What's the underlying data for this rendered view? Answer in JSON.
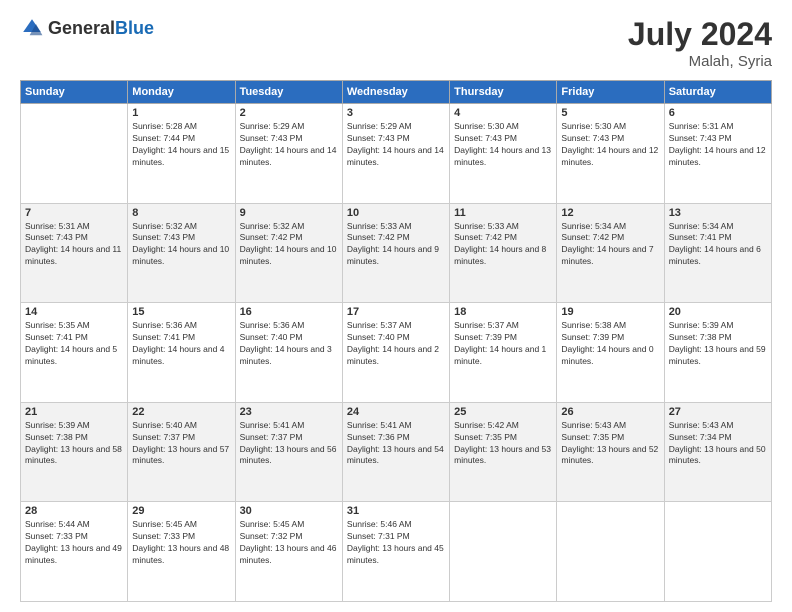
{
  "header": {
    "logo_general": "General",
    "logo_blue": "Blue",
    "month_year": "July 2024",
    "location": "Malah, Syria"
  },
  "weekdays": [
    "Sunday",
    "Monday",
    "Tuesday",
    "Wednesday",
    "Thursday",
    "Friday",
    "Saturday"
  ],
  "weeks": [
    [
      {
        "day": "",
        "sunrise": "",
        "sunset": "",
        "daylight": ""
      },
      {
        "day": "1",
        "sunrise": "Sunrise: 5:28 AM",
        "sunset": "Sunset: 7:44 PM",
        "daylight": "Daylight: 14 hours and 15 minutes."
      },
      {
        "day": "2",
        "sunrise": "Sunrise: 5:29 AM",
        "sunset": "Sunset: 7:43 PM",
        "daylight": "Daylight: 14 hours and 14 minutes."
      },
      {
        "day": "3",
        "sunrise": "Sunrise: 5:29 AM",
        "sunset": "Sunset: 7:43 PM",
        "daylight": "Daylight: 14 hours and 14 minutes."
      },
      {
        "day": "4",
        "sunrise": "Sunrise: 5:30 AM",
        "sunset": "Sunset: 7:43 PM",
        "daylight": "Daylight: 14 hours and 13 minutes."
      },
      {
        "day": "5",
        "sunrise": "Sunrise: 5:30 AM",
        "sunset": "Sunset: 7:43 PM",
        "daylight": "Daylight: 14 hours and 12 minutes."
      },
      {
        "day": "6",
        "sunrise": "Sunrise: 5:31 AM",
        "sunset": "Sunset: 7:43 PM",
        "daylight": "Daylight: 14 hours and 12 minutes."
      }
    ],
    [
      {
        "day": "7",
        "sunrise": "Sunrise: 5:31 AM",
        "sunset": "Sunset: 7:43 PM",
        "daylight": "Daylight: 14 hours and 11 minutes."
      },
      {
        "day": "8",
        "sunrise": "Sunrise: 5:32 AM",
        "sunset": "Sunset: 7:43 PM",
        "daylight": "Daylight: 14 hours and 10 minutes."
      },
      {
        "day": "9",
        "sunrise": "Sunrise: 5:32 AM",
        "sunset": "Sunset: 7:42 PM",
        "daylight": "Daylight: 14 hours and 10 minutes."
      },
      {
        "day": "10",
        "sunrise": "Sunrise: 5:33 AM",
        "sunset": "Sunset: 7:42 PM",
        "daylight": "Daylight: 14 hours and 9 minutes."
      },
      {
        "day": "11",
        "sunrise": "Sunrise: 5:33 AM",
        "sunset": "Sunset: 7:42 PM",
        "daylight": "Daylight: 14 hours and 8 minutes."
      },
      {
        "day": "12",
        "sunrise": "Sunrise: 5:34 AM",
        "sunset": "Sunset: 7:42 PM",
        "daylight": "Daylight: 14 hours and 7 minutes."
      },
      {
        "day": "13",
        "sunrise": "Sunrise: 5:34 AM",
        "sunset": "Sunset: 7:41 PM",
        "daylight": "Daylight: 14 hours and 6 minutes."
      }
    ],
    [
      {
        "day": "14",
        "sunrise": "Sunrise: 5:35 AM",
        "sunset": "Sunset: 7:41 PM",
        "daylight": "Daylight: 14 hours and 5 minutes."
      },
      {
        "day": "15",
        "sunrise": "Sunrise: 5:36 AM",
        "sunset": "Sunset: 7:41 PM",
        "daylight": "Daylight: 14 hours and 4 minutes."
      },
      {
        "day": "16",
        "sunrise": "Sunrise: 5:36 AM",
        "sunset": "Sunset: 7:40 PM",
        "daylight": "Daylight: 14 hours and 3 minutes."
      },
      {
        "day": "17",
        "sunrise": "Sunrise: 5:37 AM",
        "sunset": "Sunset: 7:40 PM",
        "daylight": "Daylight: 14 hours and 2 minutes."
      },
      {
        "day": "18",
        "sunrise": "Sunrise: 5:37 AM",
        "sunset": "Sunset: 7:39 PM",
        "daylight": "Daylight: 14 hours and 1 minute."
      },
      {
        "day": "19",
        "sunrise": "Sunrise: 5:38 AM",
        "sunset": "Sunset: 7:39 PM",
        "daylight": "Daylight: 14 hours and 0 minutes."
      },
      {
        "day": "20",
        "sunrise": "Sunrise: 5:39 AM",
        "sunset": "Sunset: 7:38 PM",
        "daylight": "Daylight: 13 hours and 59 minutes."
      }
    ],
    [
      {
        "day": "21",
        "sunrise": "Sunrise: 5:39 AM",
        "sunset": "Sunset: 7:38 PM",
        "daylight": "Daylight: 13 hours and 58 minutes."
      },
      {
        "day": "22",
        "sunrise": "Sunrise: 5:40 AM",
        "sunset": "Sunset: 7:37 PM",
        "daylight": "Daylight: 13 hours and 57 minutes."
      },
      {
        "day": "23",
        "sunrise": "Sunrise: 5:41 AM",
        "sunset": "Sunset: 7:37 PM",
        "daylight": "Daylight: 13 hours and 56 minutes."
      },
      {
        "day": "24",
        "sunrise": "Sunrise: 5:41 AM",
        "sunset": "Sunset: 7:36 PM",
        "daylight": "Daylight: 13 hours and 54 minutes."
      },
      {
        "day": "25",
        "sunrise": "Sunrise: 5:42 AM",
        "sunset": "Sunset: 7:35 PM",
        "daylight": "Daylight: 13 hours and 53 minutes."
      },
      {
        "day": "26",
        "sunrise": "Sunrise: 5:43 AM",
        "sunset": "Sunset: 7:35 PM",
        "daylight": "Daylight: 13 hours and 52 minutes."
      },
      {
        "day": "27",
        "sunrise": "Sunrise: 5:43 AM",
        "sunset": "Sunset: 7:34 PM",
        "daylight": "Daylight: 13 hours and 50 minutes."
      }
    ],
    [
      {
        "day": "28",
        "sunrise": "Sunrise: 5:44 AM",
        "sunset": "Sunset: 7:33 PM",
        "daylight": "Daylight: 13 hours and 49 minutes."
      },
      {
        "day": "29",
        "sunrise": "Sunrise: 5:45 AM",
        "sunset": "Sunset: 7:33 PM",
        "daylight": "Daylight: 13 hours and 48 minutes."
      },
      {
        "day": "30",
        "sunrise": "Sunrise: 5:45 AM",
        "sunset": "Sunset: 7:32 PM",
        "daylight": "Daylight: 13 hours and 46 minutes."
      },
      {
        "day": "31",
        "sunrise": "Sunrise: 5:46 AM",
        "sunset": "Sunset: 7:31 PM",
        "daylight": "Daylight: 13 hours and 45 minutes."
      },
      {
        "day": "",
        "sunrise": "",
        "sunset": "",
        "daylight": ""
      },
      {
        "day": "",
        "sunrise": "",
        "sunset": "",
        "daylight": ""
      },
      {
        "day": "",
        "sunrise": "",
        "sunset": "",
        "daylight": ""
      }
    ]
  ]
}
